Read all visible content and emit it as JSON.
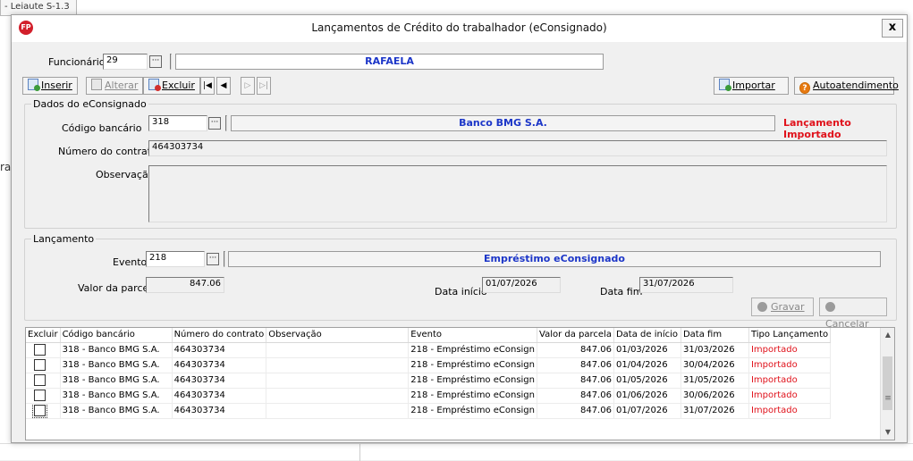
{
  "background": {
    "tab_label": "- Leiaute S-1.3",
    "left_fragment": "ra"
  },
  "dialog": {
    "title": "Lançamentos de Crédito do trabalhador (eConsignado)",
    "close_label": "x",
    "funcionario": {
      "label": "Funcionário",
      "code": "29",
      "name": "RAFAELA"
    },
    "toolbar": {
      "insert": "Inserir",
      "alter": "Alterar",
      "delete": "Excluir",
      "first": "|◀",
      "prev": "◀",
      "next": "▷",
      "last": "▷|",
      "import": "Importar",
      "selfservice": "Autoatendimento"
    },
    "dados": {
      "legend": "Dados do eConsignado",
      "codigo_label": "Código bancário",
      "codigo_value": "318",
      "banco_name": "Banco BMG S.A.",
      "status": "Lançamento Importado",
      "contrato_label": "Número do contrato",
      "contrato_value": "464303734",
      "obs_label": "Observação",
      "obs_value": ""
    },
    "lancamento": {
      "legend": "Lançamento",
      "evento_label": "Evento",
      "evento_code": "218",
      "evento_name": "Empréstimo eConsignado",
      "parcela_label": "Valor da parcela",
      "parcela_value": "847.06",
      "inicio_label": "Data início",
      "inicio_value": "01/07/2026",
      "fim_label": "Data fim",
      "fim_value": "31/07/2026",
      "gravar": "Gravar",
      "cancelar": "Cancelar"
    },
    "grid": {
      "columns": [
        "Excluir",
        "Código bancário",
        "Número do contrato",
        "Observação",
        "Evento",
        "Valor da parcela",
        "Data de início",
        "Data fim",
        "Tipo Lançamento"
      ],
      "rows": [
        {
          "banco": "318 - Banco BMG S.A.",
          "contrato": "464303734",
          "obs": "",
          "evento": "218 - Empréstimo eConsign",
          "valor": "847.06",
          "inicio": "01/03/2026",
          "fim": "31/03/2026",
          "tipo": "Importado"
        },
        {
          "banco": "318 - Banco BMG S.A.",
          "contrato": "464303734",
          "obs": "",
          "evento": "218 - Empréstimo eConsign",
          "valor": "847.06",
          "inicio": "01/04/2026",
          "fim": "30/04/2026",
          "tipo": "Importado"
        },
        {
          "banco": "318 - Banco BMG S.A.",
          "contrato": "464303734",
          "obs": "",
          "evento": "218 - Empréstimo eConsign",
          "valor": "847.06",
          "inicio": "01/05/2026",
          "fim": "31/05/2026",
          "tipo": "Importado"
        },
        {
          "banco": "318 - Banco BMG S.A.",
          "contrato": "464303734",
          "obs": "",
          "evento": "218 - Empréstimo eConsign",
          "valor": "847.06",
          "inicio": "01/06/2026",
          "fim": "30/06/2026",
          "tipo": "Importado"
        },
        {
          "banco": "318 - Banco BMG S.A.",
          "contrato": "464303734",
          "obs": "",
          "evento": "218 - Empréstimo eConsign",
          "valor": "847.06",
          "inicio": "01/07/2026",
          "fim": "31/07/2026",
          "tipo": "Importado"
        }
      ]
    }
  }
}
